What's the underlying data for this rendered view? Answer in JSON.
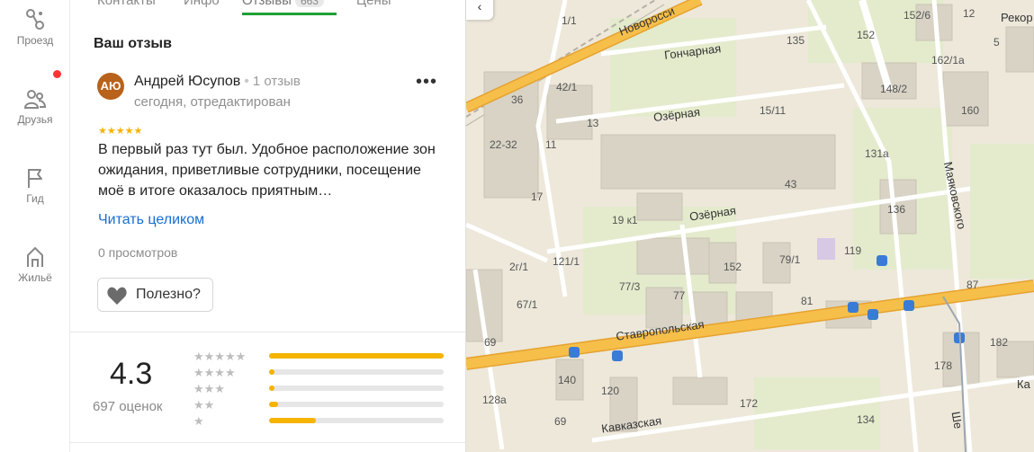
{
  "rail": {
    "items": [
      {
        "label": "Проезд",
        "icon": "route-icon"
      },
      {
        "label": "Друзья",
        "icon": "friends-icon"
      },
      {
        "label": "Гид",
        "icon": "flag-icon"
      },
      {
        "label": "Жильё",
        "icon": "house-icon"
      }
    ]
  },
  "tabs": {
    "contacts": "Контакты",
    "info": "Инфо",
    "reviews": "Отзывы",
    "reviews_count": "663",
    "prices": "Цены"
  },
  "review": {
    "section_title": "Ваш отзыв",
    "avatar_initials": "АЮ",
    "author": "Андрей Юсупов",
    "author_reviews": "1 отзыв",
    "date": "сегодня, отредактирован",
    "stars": "★★★★★",
    "rating": 5,
    "text": "В первый раз тут был. Удобное расположение зон ожидания, приветливые сотрудники, посещение моё в итоге оказалось приятным…",
    "read_more": "Читать целиком",
    "views": "0 просмотров",
    "useful": "Полезно?"
  },
  "summary": {
    "rating": "4.3",
    "count": "697 оценок",
    "histogram": [
      {
        "stars": "★★★★★",
        "share": 1.0
      },
      {
        "stars": "★★★★",
        "share": 0.03
      },
      {
        "stars": "★★★",
        "share": 0.03
      },
      {
        "stars": "★★",
        "share": 0.05
      },
      {
        "stars": "★",
        "share": 0.27
      }
    ]
  },
  "map": {
    "streets": {
      "novoross": "Новоросси",
      "goncharnaya": "Гончарная",
      "ozernaya1": "Озёрная",
      "ozernaya2": "Озёрная",
      "mayakovskogo": "Маяковского",
      "stavropolskaya": "Ставропольская",
      "kavkazskaya": "Кавказская",
      "ka": "Ка",
      "she": "Ше",
      "rekor": "Рекор"
    },
    "houses": [
      "1/1",
      "135",
      "152",
      "152/6",
      "12",
      "5",
      "162/1а",
      "42/1",
      "148/2",
      "36",
      "13",
      "15/11",
      "160",
      "22-32",
      "11",
      "131а",
      "17",
      "43",
      "19 к1",
      "136",
      "2г/1",
      "121/1",
      "119",
      "152",
      "79/1",
      "67/1",
      "77/3",
      "77",
      "81",
      "87",
      "69",
      "182",
      "178",
      "140",
      "120",
      "128а",
      "172",
      "134",
      "69"
    ],
    "colors": {
      "road": "#f6b73c",
      "bg": "#ede8da",
      "building": "#d9d4c7",
      "park": "#e1ecc7"
    }
  }
}
